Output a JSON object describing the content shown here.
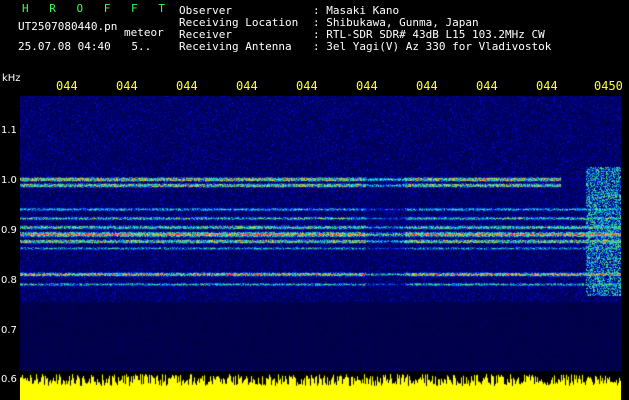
{
  "header": {
    "brand": "H R O F F T",
    "filename": "UT2507080440.pn",
    "kind": "meteor",
    "datetime": "25.07.08 04:40",
    "datetime_extra": "5.."
  },
  "info": {
    "observer_label": "Observer",
    "observer_value": ": Masaki Kano",
    "location_label": "Receiving Location",
    "location_value": ": Shibukawa, Gunma, Japan",
    "receiver_label": "Receiver",
    "receiver_value": ": RTL-SDR SDR# 43dB L15 103.2MHz CW",
    "antenna_label": "Receiving Antenna",
    "antenna_value": ": 3el Yagi(V) Az 330 for Vladivostok"
  },
  "axis": {
    "unit": "kHz",
    "time_labels": [
      "044",
      "044",
      "044",
      "044",
      "044",
      "044",
      "044",
      "044",
      "044",
      "0450"
    ],
    "freq_labels": [
      "1.1",
      "1.0",
      "0.9",
      "0.8",
      "0.7",
      "0.6"
    ]
  },
  "colors": {
    "brand": "#35ff4f",
    "time_label": "#ffff33",
    "background": "#00002a",
    "amplitude": "#ffff00"
  }
}
